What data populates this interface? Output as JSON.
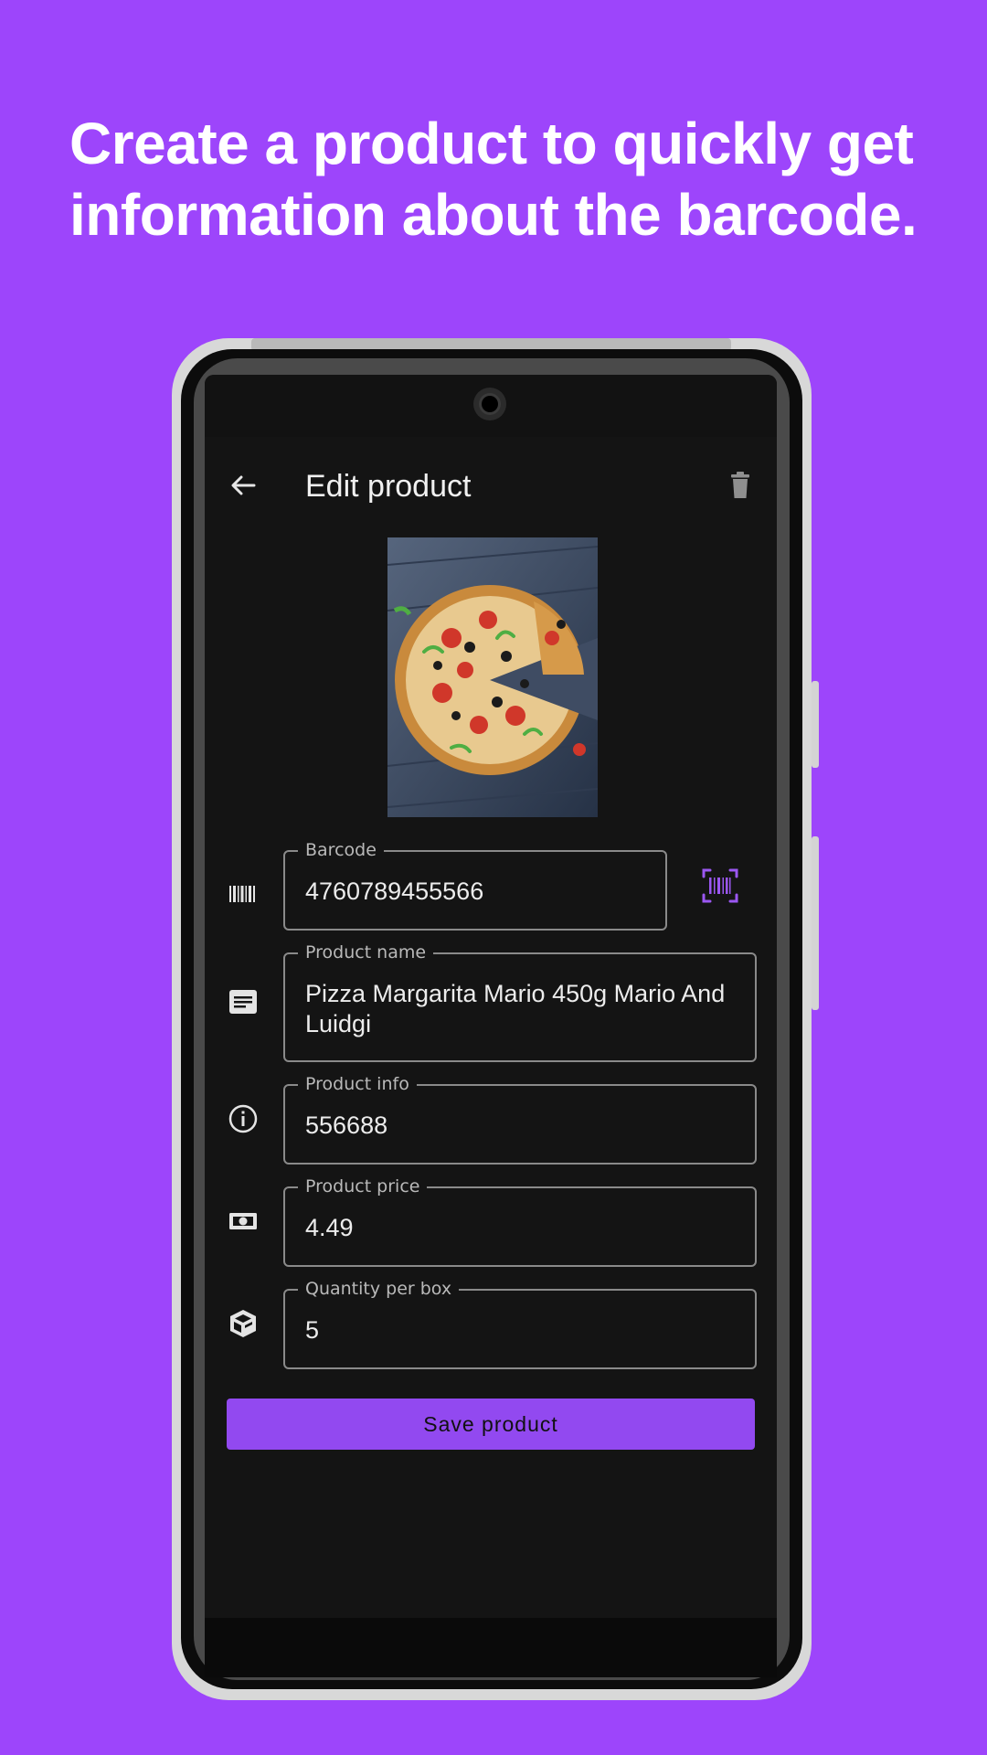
{
  "headline": {
    "line1": "Create a product to quickly get",
    "line2": "information about the barcode."
  },
  "app_bar": {
    "title": "Edit product",
    "back_icon": "arrow-back-icon",
    "delete_icon": "trash-icon"
  },
  "product_image": {
    "subject": "pizza-photo"
  },
  "fields": {
    "barcode": {
      "label": "Barcode",
      "value": "4760789455566",
      "icon": "barcode-icon"
    },
    "name": {
      "label": "Product name",
      "value": "Pizza Margarita Mario 450g Mario And Luidgi",
      "icon": "notes-icon"
    },
    "info": {
      "label": "Product info",
      "value": "556688",
      "icon": "info-icon"
    },
    "price": {
      "label": "Product price",
      "value": "4.49",
      "icon": "money-icon"
    },
    "quantity": {
      "label": "Quantity per box",
      "value": "5",
      "icon": "box-icon"
    }
  },
  "scan_button": {
    "icon": "barcode-scan-icon"
  },
  "save_button": {
    "label": "Save product"
  },
  "colors": {
    "background": "#9d45fb",
    "accent": "#9249f0",
    "screen": "#141414"
  }
}
